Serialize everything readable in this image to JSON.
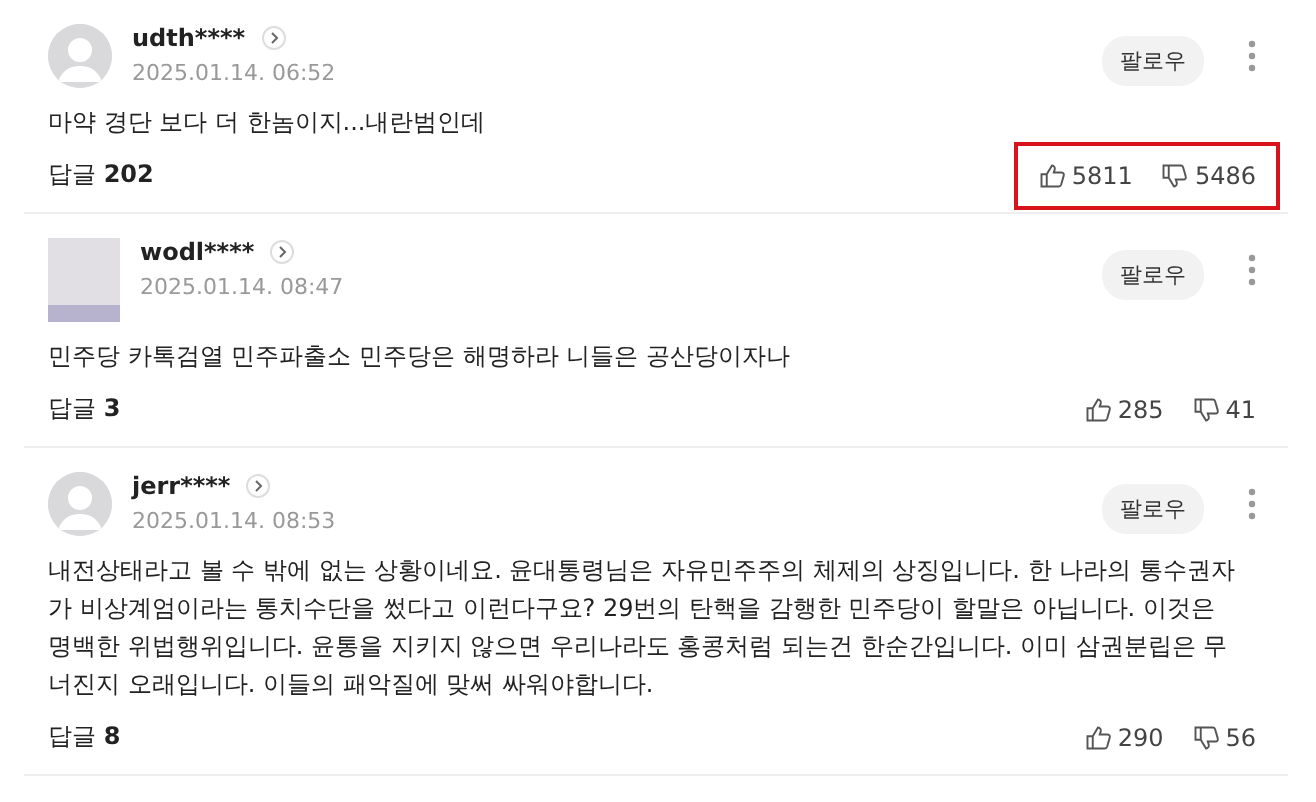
{
  "comments": [
    {
      "kind": "default",
      "user": "udth****",
      "date": "2025.01.14. 06:52",
      "follow": "팔로우",
      "text": "마약 경단 보다 더 한놈이지...내란범인데",
      "reply_label": "답글",
      "reply_count": "202",
      "likes": "5811",
      "dislikes": "5486",
      "highlighted": true
    },
    {
      "kind": "photo",
      "user": "wodl****",
      "date": "2025.01.14. 08:47",
      "follow": "팔로우",
      "text": "민주당 카톡검열 민주파출소 민주당은 해명하라 니들은 공산당이자나",
      "reply_label": "답글",
      "reply_count": "3",
      "likes": "285",
      "dislikes": "41",
      "highlighted": false
    },
    {
      "kind": "default",
      "user": "jerr****",
      "date": "2025.01.14. 08:53",
      "follow": "팔로우",
      "text": "내전상태라고 볼 수 밖에 없는 상황이네요. 윤대통령님은 자유민주주의 체제의 상징입니다. 한 나라의 통수권자가 비상계엄이라는 통치수단을 썼다고 이런다구요? 29번의 탄핵을 감행한 민주당이 할말은 아닙니다. 이것은 명백한 위법행위입니다. 윤통을 지키지 않으면 우리나라도 홍콩처럼 되는건 한순간입니다. 이미 삼권분립은 무너진지 오래입니다. 이들의 패악질에 맞써 싸워야합니다.",
      "reply_label": "답글",
      "reply_count": "8",
      "likes": "290",
      "dislikes": "56",
      "highlighted": false
    }
  ]
}
